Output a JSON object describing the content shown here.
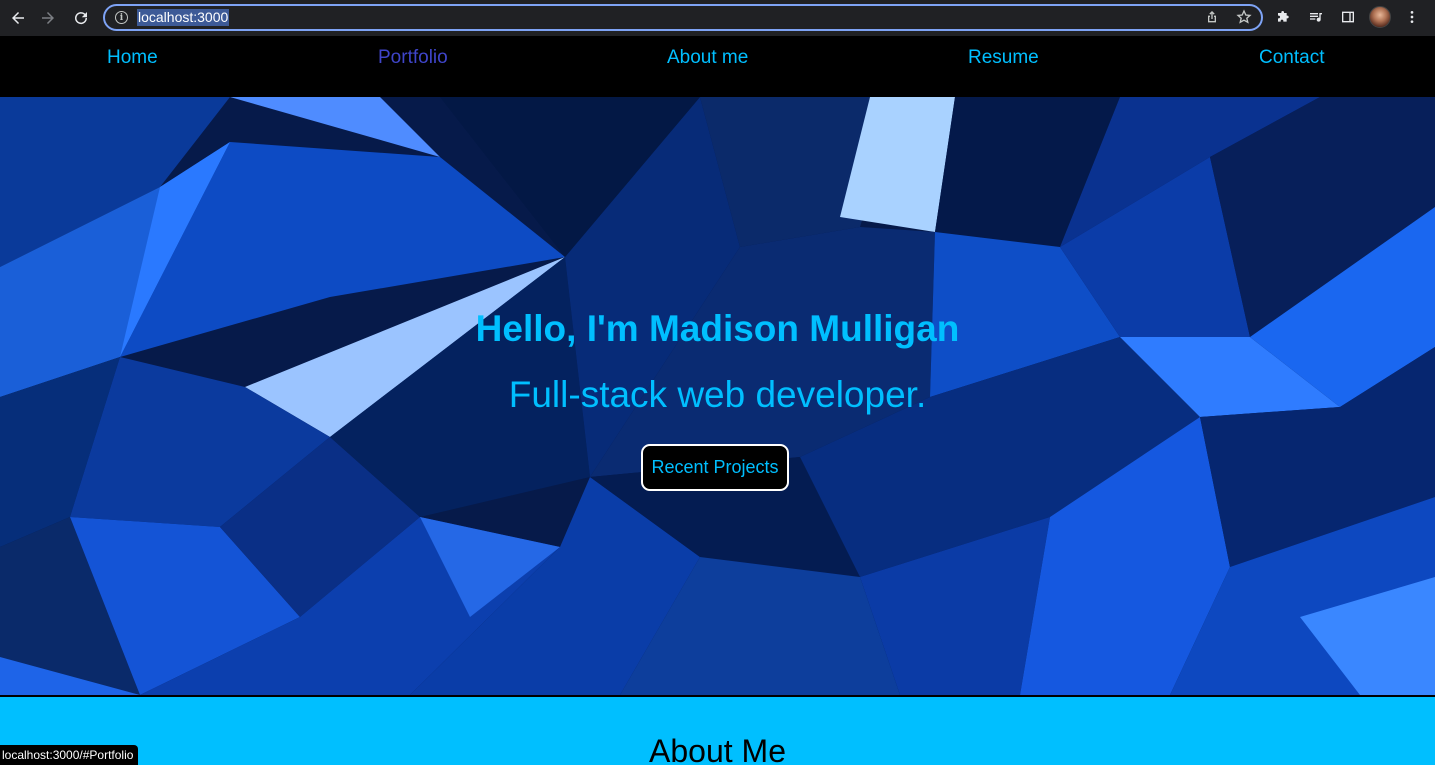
{
  "browser": {
    "url": "localhost:3000",
    "status_url": "localhost:3000/#Portfolio",
    "icons": {
      "back": "arrow-left-icon",
      "forward": "arrow-right-icon",
      "reload": "reload-icon",
      "site_info": "info-icon",
      "share": "share-icon",
      "bookmark": "star-icon",
      "extensions": "puzzle-icon",
      "media": "media-queue-icon",
      "side_panel": "side-panel-icon",
      "profile": "avatar",
      "menu": "kebab-menu-icon"
    }
  },
  "nav": {
    "items": [
      {
        "label": "Home"
      },
      {
        "label": "Portfolio",
        "active": true
      },
      {
        "label": "About me"
      },
      {
        "label": "Resume"
      },
      {
        "label": "Contact"
      }
    ]
  },
  "hero": {
    "title": "Hello, I'm Madison Mulligan",
    "subtitle": "Full-stack web developer.",
    "button_label": "Recent Projects"
  },
  "about": {
    "heading": "About Me"
  },
  "colors": {
    "accent": "#00bfff",
    "nav_active": "#3f45c9",
    "nav_bg": "#000000",
    "about_bg": "#00bfff",
    "chrome_bg": "#202124",
    "omnibox_border": "#7ea3f5"
  }
}
